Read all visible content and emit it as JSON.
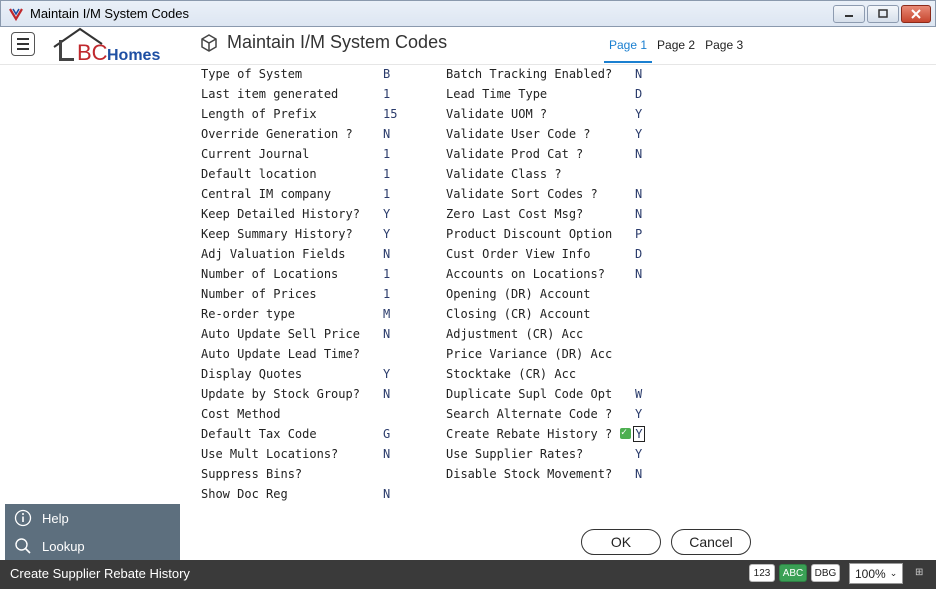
{
  "window": {
    "title": "Maintain I/M System Codes"
  },
  "header": {
    "logo_text_prefix": "BC",
    "logo_text_suffix": "Homes",
    "page_title": "Maintain I/M System Codes",
    "tabs": [
      {
        "label": "Page 1",
        "active": true
      },
      {
        "label": "Page 2",
        "active": false
      },
      {
        "label": "Page 3",
        "active": false
      }
    ]
  },
  "left_fields": [
    {
      "label": "Type of System",
      "value": "B"
    },
    {
      "label": "Last item generated",
      "value": "1"
    },
    {
      "label": "Length of Prefix",
      "value": "15"
    },
    {
      "label": "Override Generation ?",
      "value": "N"
    },
    {
      "label": "Current Journal",
      "value": "1"
    },
    {
      "label": "Default location",
      "value": "1"
    },
    {
      "label": "Central IM company",
      "value": "1"
    },
    {
      "label": "Keep Detailed History?",
      "value": "Y"
    },
    {
      "label": "Keep Summary History?",
      "value": "Y"
    },
    {
      "label": "Adj Valuation Fields",
      "value": "N"
    },
    {
      "label": "Number of Locations",
      "value": "1"
    },
    {
      "label": "Number of Prices",
      "value": "1"
    },
    {
      "label": "Re-order type",
      "value": "M"
    },
    {
      "label": "Auto Update Sell Price",
      "value": "N"
    },
    {
      "label": "Auto Update Lead Time?",
      "value": ""
    },
    {
      "label": "Display Quotes",
      "value": "Y"
    },
    {
      "label": "Update by Stock Group?",
      "value": "N"
    },
    {
      "label": "Cost Method",
      "value": ""
    },
    {
      "label": "Default Tax Code",
      "value": "G"
    },
    {
      "label": "Use Mult Locations?",
      "value": "N"
    },
    {
      "label": "Suppress Bins?",
      "value": ""
    },
    {
      "label": "Show Doc Reg",
      "value": "N"
    }
  ],
  "right_fields": [
    {
      "label": "Batch Tracking Enabled?",
      "value": "N"
    },
    {
      "label": "Lead Time Type",
      "value": "D"
    },
    {
      "label": "Validate UOM ?",
      "value": "Y"
    },
    {
      "label": "Validate User Code ?",
      "value": "Y"
    },
    {
      "label": "Validate Prod Cat ?",
      "value": "N"
    },
    {
      "label": "Validate Class ?",
      "value": ""
    },
    {
      "label": "Validate Sort Codes ?",
      "value": "N"
    },
    {
      "label": "Zero Last Cost Msg?",
      "value": "N"
    },
    {
      "label": "Product Discount Option",
      "value": "P"
    },
    {
      "label": "Cust Order View Info",
      "value": "D"
    },
    {
      "label": "Accounts on Locations?",
      "value": "N"
    },
    {
      "label": "Opening (DR) Account",
      "value": ""
    },
    {
      "label": "Closing (CR) Account",
      "value": ""
    },
    {
      "label": "Adjustment (CR) Acc",
      "value": ""
    },
    {
      "label": "Price Variance (DR) Acc",
      "value": ""
    },
    {
      "label": "Stocktake (CR) Acc",
      "value": ""
    },
    {
      "label": "Duplicate Supl Code Opt",
      "value": "W"
    },
    {
      "label": "Search Alternate Code ?",
      "value": "Y"
    },
    {
      "label": "Create Rebate History ?",
      "value": "Y",
      "focused": true
    },
    {
      "label": "Use Supplier Rates?",
      "value": "Y"
    },
    {
      "label": "Disable Stock Movement?",
      "value": "N"
    }
  ],
  "side_panel": {
    "help_label": "Help",
    "lookup_label": "Lookup"
  },
  "buttons": {
    "ok_label": "OK",
    "cancel_label": "Cancel"
  },
  "statusbar": {
    "text": "Create Supplier Rebate History",
    "num_indicator": "123",
    "caps_indicator": "ABC",
    "dbg_indicator": "DBG",
    "zoom": "100%"
  },
  "colors": {
    "accent": "#1a7fd0",
    "side_panel": "#5d6f7e",
    "status_bar": "#3a3a3a",
    "caps_on": "#3aa055"
  }
}
